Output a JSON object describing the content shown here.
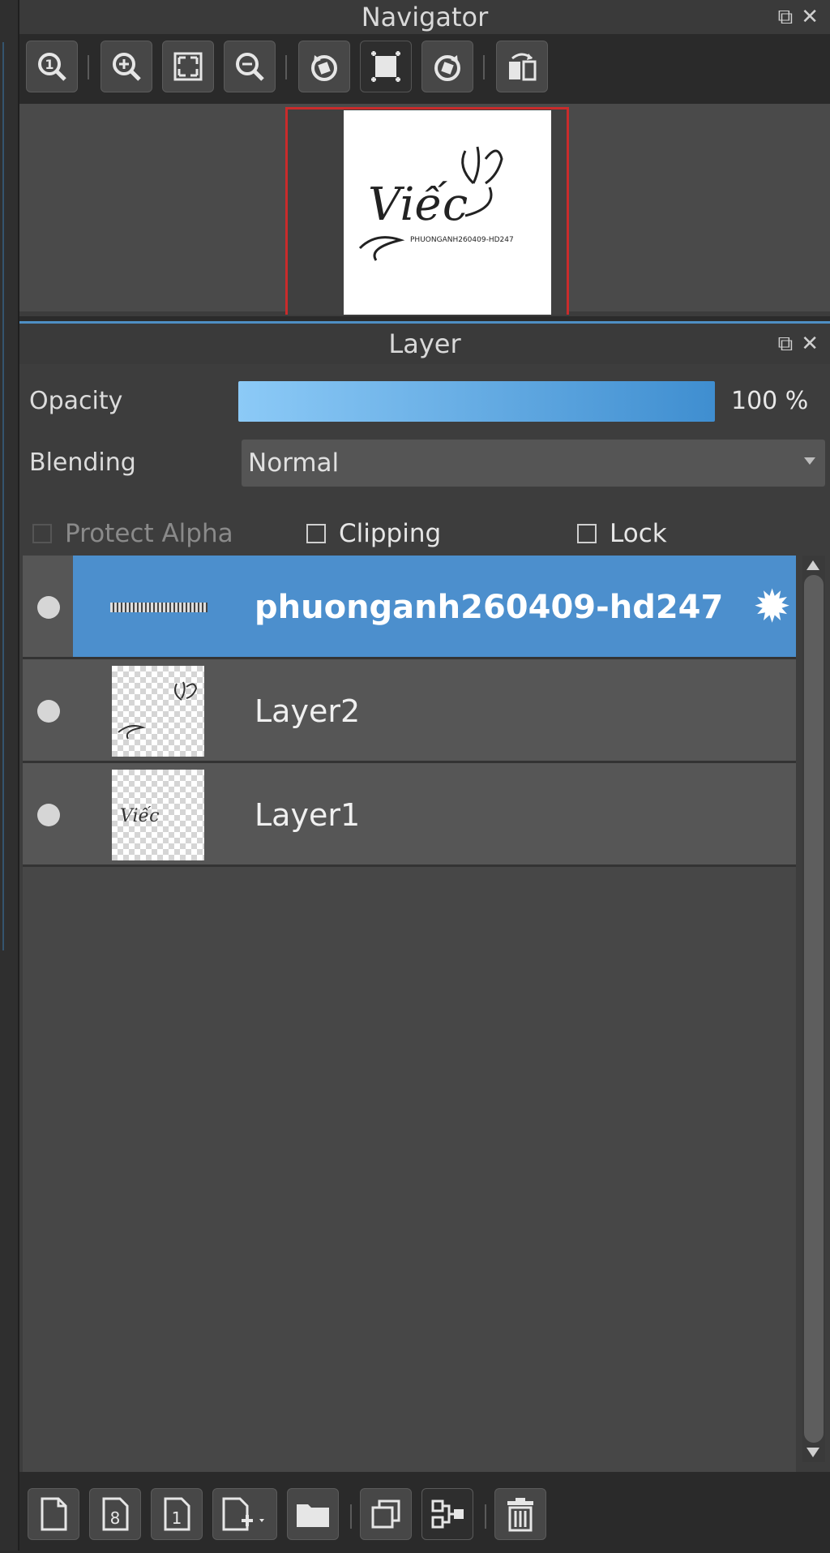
{
  "navigator": {
    "title": "Navigator",
    "toolbar": [
      {
        "name": "zoom-actual-size-icon"
      },
      {
        "name": "zoom-in-icon"
      },
      {
        "name": "fit-to-window-icon"
      },
      {
        "name": "zoom-out-icon"
      },
      {
        "name": "rotate-left-icon"
      },
      {
        "name": "reset-rotation-icon"
      },
      {
        "name": "rotate-right-icon"
      },
      {
        "name": "flip-horizontal-icon"
      }
    ],
    "preview": {
      "main_text": "Viếc",
      "sub_text": "PHUONGANH260409-HD247"
    }
  },
  "layer_panel": {
    "title": "Layer",
    "opacity_label": "Opacity",
    "opacity_value": "100 %",
    "opacity_fraction": 1.0,
    "blending_label": "Blending",
    "blending_value": "Normal",
    "protect_alpha_label": "Protect Alpha",
    "clipping_label": "Clipping",
    "lock_label": "Lock",
    "layers": [
      {
        "name": "phuonganh260409-hd247",
        "selected": true
      },
      {
        "name": "Layer2",
        "selected": false
      },
      {
        "name": "Layer1",
        "selected": false,
        "thumb_text": "Viếc"
      }
    ],
    "bottom_toolbar": [
      {
        "name": "new-layer-icon"
      },
      {
        "name": "new-8bit-layer-icon"
      },
      {
        "name": "new-1bit-layer-icon"
      },
      {
        "name": "add-layer-dropdown-icon"
      },
      {
        "name": "new-folder-icon"
      },
      {
        "name": "duplicate-layer-icon"
      },
      {
        "name": "merge-layer-icon"
      },
      {
        "name": "delete-layer-icon"
      }
    ]
  },
  "colors": {
    "accent": "#4c8fcd",
    "preview_border": "#c92b2b"
  }
}
